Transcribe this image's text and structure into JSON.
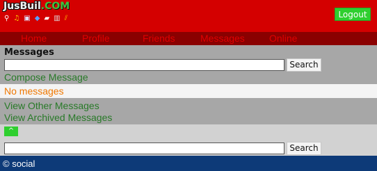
{
  "header": {
    "logo_part1": "JusBuil",
    "logo_part2": ".COM",
    "logout_label": "Logout",
    "icons": [
      "search-icon",
      "music-icon",
      "video-icon",
      "tag-icon",
      "chat-icon",
      "database-icon",
      "signal-icon"
    ]
  },
  "nav": {
    "items": [
      "Home",
      "Profile",
      "Friends",
      "Messages",
      "Online"
    ]
  },
  "messages": {
    "title": "Messages",
    "search_button": "Search",
    "search_value": "",
    "compose_link": "Compose Message",
    "empty_text": "No messages",
    "other_link": "View Other Messages",
    "archived_link": "View Archived Messages"
  },
  "bottom": {
    "up_icon": "chevron-up-icon",
    "search_button": "Search",
    "search_value": ""
  },
  "footer": {
    "text": "© social"
  },
  "colors": {
    "header_bg": "#d40000",
    "nav_bg": "#8a0000",
    "nav_text": "#e00000",
    "link": "#287a28",
    "empty_text": "#f07800",
    "button_green": "#2fcf2f",
    "footer_bg": "#0d3a78"
  }
}
